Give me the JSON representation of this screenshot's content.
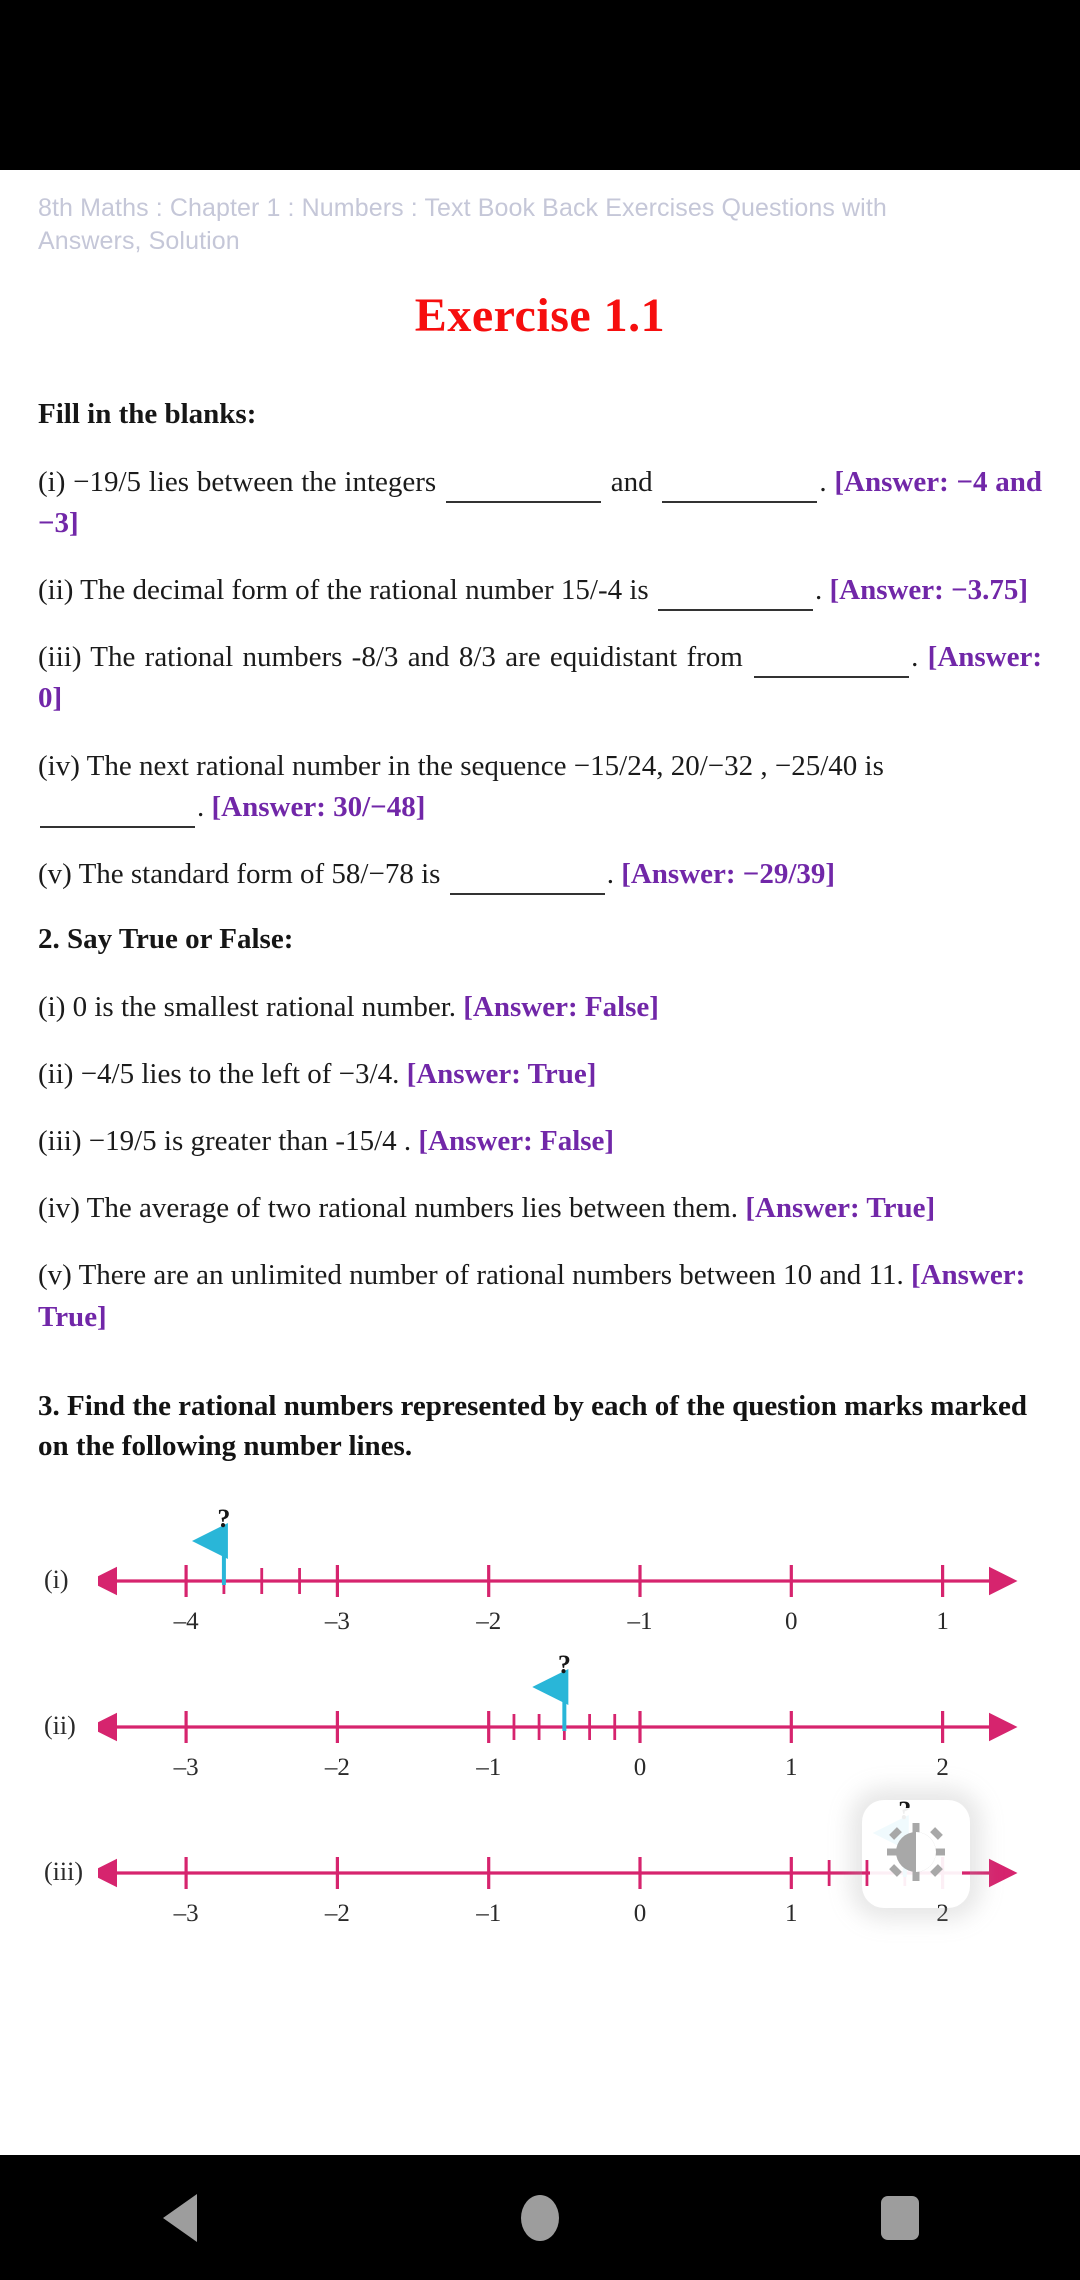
{
  "breadcrumb": "8th Maths : Chapter 1 : Numbers : Text Book Back Exercises Questions with Answers, Solution",
  "exercise_title": "Exercise 1.1",
  "colors": {
    "title_red": "#f60e0e",
    "answer_purple": "#7127a8",
    "breadcrumb_grey": "#c5c7d8",
    "number_line_pink": "#d6246e",
    "arrow_cyan": "#29b6d8"
  },
  "section1": {
    "heading": "Fill in the blanks:",
    "items": [
      {
        "marker": "(i)",
        "text_before": "−19/5 lies between the integers",
        "text_mid": "and",
        "text_after": ".",
        "answer": "[Answer: −4 and −3]",
        "blanks": 2
      },
      {
        "marker": "(ii)",
        "text_before": "The decimal form of the rational number 15/-4 is",
        "text_after": ".",
        "answer": "[Answer: −3.75]",
        "blanks": 1
      },
      {
        "marker": "(iii)",
        "text_before": "The rational numbers -8/3 and 8/3 are equidistant from",
        "text_after": ".",
        "answer": "[Answer: 0]",
        "blanks": 1
      },
      {
        "marker": "(iv)",
        "text_before": "The next rational number in the sequence −15/24, 20/−32 , −25/40 is",
        "text_after": ".",
        "answer": "[Answer: 30/−48]",
        "blanks": 1
      },
      {
        "marker": "(v)",
        "text_before": "The standard form of 58/−78 is",
        "text_after": ".",
        "answer": "[Answer: −29/39]",
        "blanks": 1
      }
    ]
  },
  "section2": {
    "heading": "2. Say True or False:",
    "items": [
      {
        "marker": "(i)",
        "text": "0 is the smallest rational number.",
        "answer": "[Answer: False]"
      },
      {
        "marker": "(ii)",
        "text": "−4/5 lies to the left of −3/4.",
        "answer": "[Answer: True]"
      },
      {
        "marker": "(iii)",
        "text": "−19/5 is greater than -15/4 .",
        "answer": "[Answer: False]"
      },
      {
        "marker": "(iv)",
        "text": "The average of two rational numbers lies between them.",
        "answer": "[Answer: True]"
      },
      {
        "marker": "(v)",
        "text": "There are an unlimited number of rational numbers between 10 and 11.",
        "answer": "[Answer: True]"
      }
    ]
  },
  "section3": {
    "heading": "3. Find the rational numbers represented by each of the question marks marked on the following number lines.",
    "number_lines": [
      {
        "marker": "(i)",
        "major_labels": [
          "–4",
          "–3",
          "–2",
          "–1",
          "0",
          "1"
        ],
        "axis_min": -4.45,
        "axis_max": 1.3,
        "major_values": [
          -4,
          -3,
          -2,
          -1,
          0,
          1
        ],
        "minor_values": [
          -3.75,
          -3.5,
          -3.25
        ],
        "marker_value": -3.75,
        "question_mark": "?"
      },
      {
        "marker": "(ii)",
        "major_labels": [
          "–3",
          "–2",
          "–1",
          "0",
          "1",
          "2"
        ],
        "axis_min": -3.45,
        "axis_max": 2.3,
        "major_values": [
          -3,
          -2,
          -1,
          0,
          1,
          2
        ],
        "minor_values": [
          -0.833,
          -0.667,
          -0.5,
          -0.333,
          -0.167
        ],
        "marker_value": -0.5,
        "question_mark": "?"
      },
      {
        "marker": "(iii)",
        "major_labels": [
          "–3",
          "–2",
          "–1",
          "0",
          "1",
          "2"
        ],
        "axis_min": -3.45,
        "axis_max": 2.3,
        "major_values": [
          -3,
          -2,
          -1,
          0,
          1,
          2
        ],
        "minor_values": [
          1.25,
          1.5,
          1.75
        ],
        "marker_value": 1.75,
        "question_mark": "?"
      }
    ]
  },
  "brightness_widget": {
    "icon": "brightness-contrast-icon"
  },
  "nav_bar": {
    "back": "back-button",
    "home": "home-button",
    "recents": "recents-button"
  }
}
